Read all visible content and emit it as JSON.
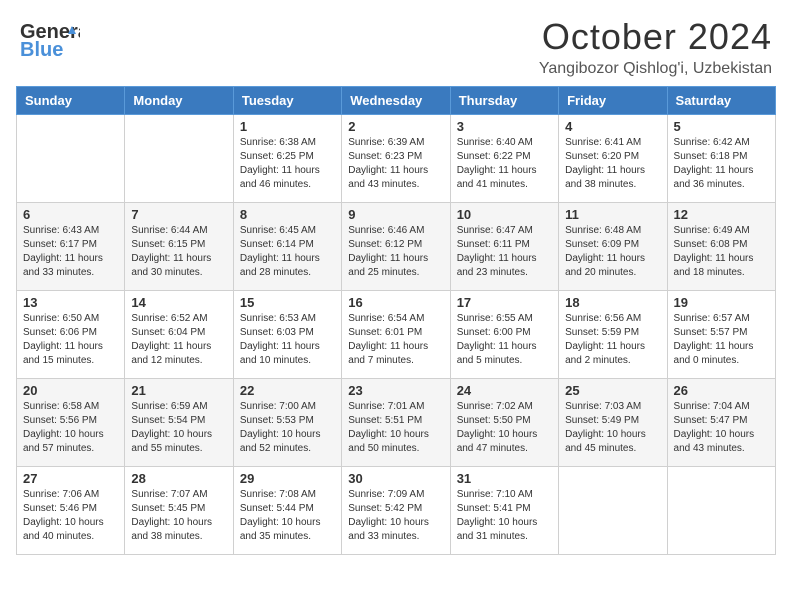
{
  "header": {
    "logo_line1": "General",
    "logo_line2": "Blue",
    "month": "October 2024",
    "location": "Yangibozor Qishlog'i, Uzbekistan"
  },
  "days_of_week": [
    "Sunday",
    "Monday",
    "Tuesday",
    "Wednesday",
    "Thursday",
    "Friday",
    "Saturday"
  ],
  "weeks": [
    [
      {
        "num": "",
        "sunrise": "",
        "sunset": "",
        "daylight": ""
      },
      {
        "num": "",
        "sunrise": "",
        "sunset": "",
        "daylight": ""
      },
      {
        "num": "1",
        "sunrise": "Sunrise: 6:38 AM",
        "sunset": "Sunset: 6:25 PM",
        "daylight": "Daylight: 11 hours and 46 minutes."
      },
      {
        "num": "2",
        "sunrise": "Sunrise: 6:39 AM",
        "sunset": "Sunset: 6:23 PM",
        "daylight": "Daylight: 11 hours and 43 minutes."
      },
      {
        "num": "3",
        "sunrise": "Sunrise: 6:40 AM",
        "sunset": "Sunset: 6:22 PM",
        "daylight": "Daylight: 11 hours and 41 minutes."
      },
      {
        "num": "4",
        "sunrise": "Sunrise: 6:41 AM",
        "sunset": "Sunset: 6:20 PM",
        "daylight": "Daylight: 11 hours and 38 minutes."
      },
      {
        "num": "5",
        "sunrise": "Sunrise: 6:42 AM",
        "sunset": "Sunset: 6:18 PM",
        "daylight": "Daylight: 11 hours and 36 minutes."
      }
    ],
    [
      {
        "num": "6",
        "sunrise": "Sunrise: 6:43 AM",
        "sunset": "Sunset: 6:17 PM",
        "daylight": "Daylight: 11 hours and 33 minutes."
      },
      {
        "num": "7",
        "sunrise": "Sunrise: 6:44 AM",
        "sunset": "Sunset: 6:15 PM",
        "daylight": "Daylight: 11 hours and 30 minutes."
      },
      {
        "num": "8",
        "sunrise": "Sunrise: 6:45 AM",
        "sunset": "Sunset: 6:14 PM",
        "daylight": "Daylight: 11 hours and 28 minutes."
      },
      {
        "num": "9",
        "sunrise": "Sunrise: 6:46 AM",
        "sunset": "Sunset: 6:12 PM",
        "daylight": "Daylight: 11 hours and 25 minutes."
      },
      {
        "num": "10",
        "sunrise": "Sunrise: 6:47 AM",
        "sunset": "Sunset: 6:11 PM",
        "daylight": "Daylight: 11 hours and 23 minutes."
      },
      {
        "num": "11",
        "sunrise": "Sunrise: 6:48 AM",
        "sunset": "Sunset: 6:09 PM",
        "daylight": "Daylight: 11 hours and 20 minutes."
      },
      {
        "num": "12",
        "sunrise": "Sunrise: 6:49 AM",
        "sunset": "Sunset: 6:08 PM",
        "daylight": "Daylight: 11 hours and 18 minutes."
      }
    ],
    [
      {
        "num": "13",
        "sunrise": "Sunrise: 6:50 AM",
        "sunset": "Sunset: 6:06 PM",
        "daylight": "Daylight: 11 hours and 15 minutes."
      },
      {
        "num": "14",
        "sunrise": "Sunrise: 6:52 AM",
        "sunset": "Sunset: 6:04 PM",
        "daylight": "Daylight: 11 hours and 12 minutes."
      },
      {
        "num": "15",
        "sunrise": "Sunrise: 6:53 AM",
        "sunset": "Sunset: 6:03 PM",
        "daylight": "Daylight: 11 hours and 10 minutes."
      },
      {
        "num": "16",
        "sunrise": "Sunrise: 6:54 AM",
        "sunset": "Sunset: 6:01 PM",
        "daylight": "Daylight: 11 hours and 7 minutes."
      },
      {
        "num": "17",
        "sunrise": "Sunrise: 6:55 AM",
        "sunset": "Sunset: 6:00 PM",
        "daylight": "Daylight: 11 hours and 5 minutes."
      },
      {
        "num": "18",
        "sunrise": "Sunrise: 6:56 AM",
        "sunset": "Sunset: 5:59 PM",
        "daylight": "Daylight: 11 hours and 2 minutes."
      },
      {
        "num": "19",
        "sunrise": "Sunrise: 6:57 AM",
        "sunset": "Sunset: 5:57 PM",
        "daylight": "Daylight: 11 hours and 0 minutes."
      }
    ],
    [
      {
        "num": "20",
        "sunrise": "Sunrise: 6:58 AM",
        "sunset": "Sunset: 5:56 PM",
        "daylight": "Daylight: 10 hours and 57 minutes."
      },
      {
        "num": "21",
        "sunrise": "Sunrise: 6:59 AM",
        "sunset": "Sunset: 5:54 PM",
        "daylight": "Daylight: 10 hours and 55 minutes."
      },
      {
        "num": "22",
        "sunrise": "Sunrise: 7:00 AM",
        "sunset": "Sunset: 5:53 PM",
        "daylight": "Daylight: 10 hours and 52 minutes."
      },
      {
        "num": "23",
        "sunrise": "Sunrise: 7:01 AM",
        "sunset": "Sunset: 5:51 PM",
        "daylight": "Daylight: 10 hours and 50 minutes."
      },
      {
        "num": "24",
        "sunrise": "Sunrise: 7:02 AM",
        "sunset": "Sunset: 5:50 PM",
        "daylight": "Daylight: 10 hours and 47 minutes."
      },
      {
        "num": "25",
        "sunrise": "Sunrise: 7:03 AM",
        "sunset": "Sunset: 5:49 PM",
        "daylight": "Daylight: 10 hours and 45 minutes."
      },
      {
        "num": "26",
        "sunrise": "Sunrise: 7:04 AM",
        "sunset": "Sunset: 5:47 PM",
        "daylight": "Daylight: 10 hours and 43 minutes."
      }
    ],
    [
      {
        "num": "27",
        "sunrise": "Sunrise: 7:06 AM",
        "sunset": "Sunset: 5:46 PM",
        "daylight": "Daylight: 10 hours and 40 minutes."
      },
      {
        "num": "28",
        "sunrise": "Sunrise: 7:07 AM",
        "sunset": "Sunset: 5:45 PM",
        "daylight": "Daylight: 10 hours and 38 minutes."
      },
      {
        "num": "29",
        "sunrise": "Sunrise: 7:08 AM",
        "sunset": "Sunset: 5:44 PM",
        "daylight": "Daylight: 10 hours and 35 minutes."
      },
      {
        "num": "30",
        "sunrise": "Sunrise: 7:09 AM",
        "sunset": "Sunset: 5:42 PM",
        "daylight": "Daylight: 10 hours and 33 minutes."
      },
      {
        "num": "31",
        "sunrise": "Sunrise: 7:10 AM",
        "sunset": "Sunset: 5:41 PM",
        "daylight": "Daylight: 10 hours and 31 minutes."
      },
      {
        "num": "",
        "sunrise": "",
        "sunset": "",
        "daylight": ""
      },
      {
        "num": "",
        "sunrise": "",
        "sunset": "",
        "daylight": ""
      }
    ]
  ]
}
